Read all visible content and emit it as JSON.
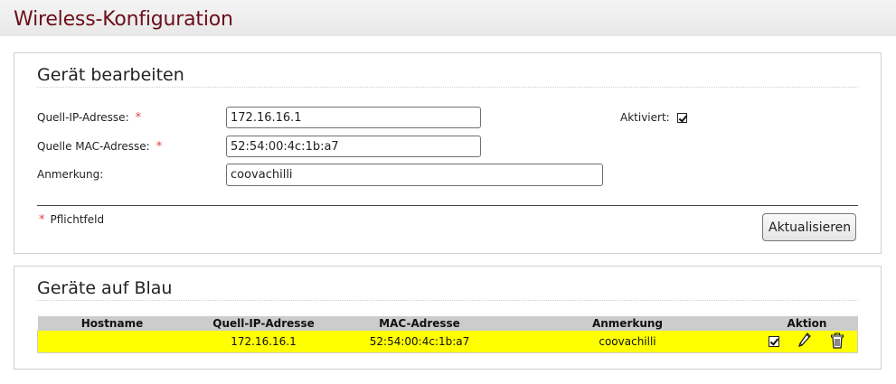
{
  "page": {
    "title": "Wireless-Konfiguration"
  },
  "edit_form": {
    "title": "Gerät bearbeiten",
    "fields": {
      "source_ip": {
        "label": "Quell-IP-Adresse:",
        "value": "172.16.16.1",
        "required_mark": "*"
      },
      "source_mac": {
        "label": "Quelle MAC-Adresse:",
        "value": "52:54:00:4c:1b:a7",
        "required_mark": "*"
      },
      "remark": {
        "label": "Anmerkung:",
        "value": "coovachilli"
      }
    },
    "enabled": {
      "label": "Aktiviert:",
      "checked": true
    },
    "required_legend": {
      "mark": "*",
      "text": "Pflichtfeld"
    },
    "update_button": "Aktualisieren"
  },
  "devices": {
    "title": "Geräte auf Blau",
    "columns": [
      "Hostname",
      "Quell-IP-Adresse",
      "MAC-Adresse",
      "Anmerkung",
      "Aktion"
    ],
    "rows": [
      {
        "hostname": "",
        "source_ip": "172.16.16.1",
        "mac": "52:54:00:4c:1b:a7",
        "remark": "coovachilli",
        "enabled": true,
        "highlight_color": "#ffff00"
      }
    ]
  },
  "colors": {
    "title": "#6b0f1a",
    "required": "#e3413f",
    "row_highlight": "#ffff00",
    "table_header": "#cccccc"
  }
}
